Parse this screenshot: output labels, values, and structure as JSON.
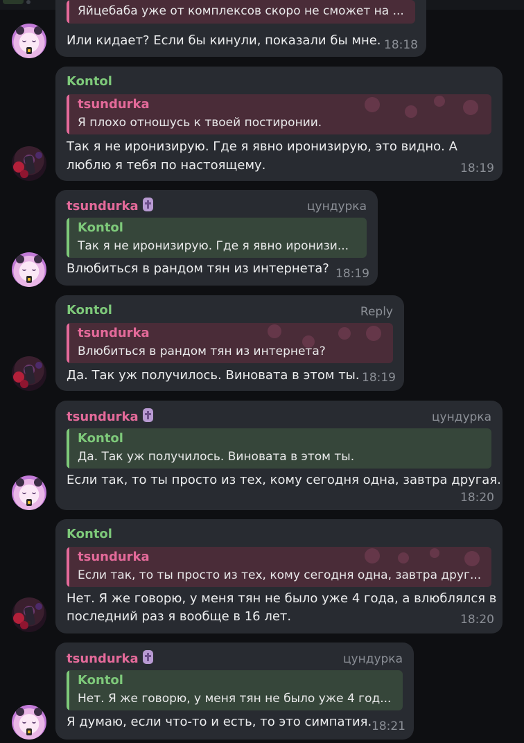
{
  "messages": [
    {
      "sender": "",
      "quote": {
        "name": "",
        "text": "Яйцебаба уже от комплексов скоро не сможет на ..."
      },
      "text": [
        "Или кидает? Если бы кинули, показали бы мне."
      ],
      "time": "18:18"
    },
    {
      "sender": "Kontol",
      "quote": {
        "name": "tsundurka",
        "text": "Я плохо отношусь к твоей постиронии."
      },
      "text": [
        "Так я не иронизирую. Где я явно иронизирую, это видно. А",
        "люблю я тебя по настоящему."
      ],
      "time": "18:19"
    },
    {
      "sender": "tsundurka",
      "right_label": "цундурка",
      "quote": {
        "name": "Kontol",
        "text": "Так я не иронизирую. Где я явно иронизи..."
      },
      "text": [
        "Влюбиться в рандом тян из интернета?"
      ],
      "time": "18:19"
    },
    {
      "sender": "Kontol",
      "right_label": "Reply",
      "quote": {
        "name": "tsundurka",
        "text": "Влюбиться в рандом тян из интернета?"
      },
      "text": [
        "Да. Так уж получилось. Виновата в этом ты."
      ],
      "time": "18:19"
    },
    {
      "sender": "tsundurka",
      "right_label": "цундурка",
      "quote": {
        "name": "Kontol",
        "text": "Да. Так уж получилось. Виновата в этом ты."
      },
      "text": [
        "Если так, то ты просто из тех, кому сегодня одна, завтра другая."
      ],
      "time": "18:20"
    },
    {
      "sender": "Kontol",
      "quote": {
        "name": "tsundurka",
        "text": "Если так, то ты просто из тех, кому сегодня одна, завтра друг..."
      },
      "text": [
        "Нет. Я же говорю, у меня тян не было уже 4 года, а влюблялся в",
        "последний раз я вообще в 16 лет."
      ],
      "time": "18:20"
    },
    {
      "sender": "tsundurka",
      "right_label": "цундурка",
      "quote": {
        "name": "Kontol",
        "text": "Нет. Я же говорю, у меня тян не было уже 4 год..."
      },
      "text": [
        "Я думаю, если что-то и есть, то это симпатия."
      ],
      "time": "18:21"
    }
  ]
}
